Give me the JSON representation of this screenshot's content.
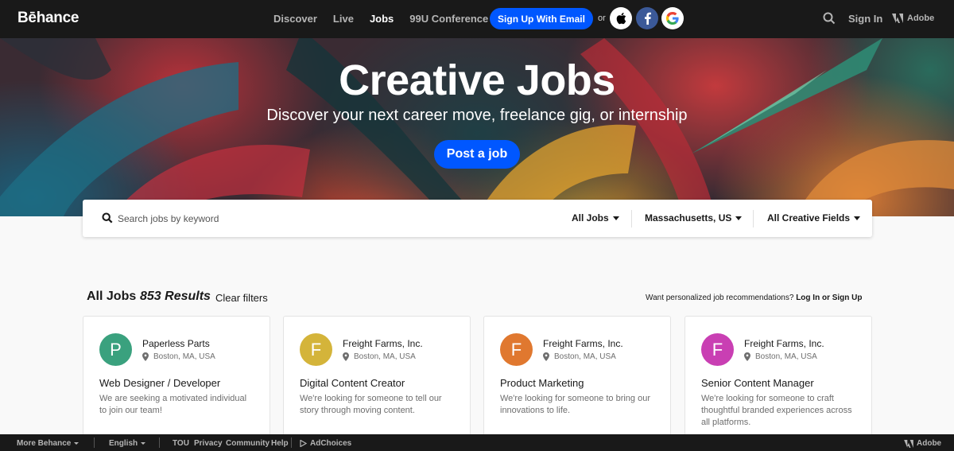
{
  "nav": {
    "logo": "Bēhance",
    "links": [
      "Discover",
      "Live",
      "Jobs",
      "99U Conference"
    ],
    "active": "Jobs",
    "signup_label": "Sign Up With Email",
    "or_label": "or",
    "signin_label": "Sign In",
    "adobe_label": "Adobe",
    "colors": {
      "background": "#191919",
      "accent": "#0057ff",
      "facebook": "#3b5998"
    }
  },
  "hero": {
    "title": "Creative Jobs",
    "subtitle": "Discover your next career move, freelance gig, or internship",
    "post_job_label": "Post a job"
  },
  "search": {
    "placeholder": "Search jobs by keyword",
    "value": "",
    "filters": [
      "All Jobs",
      "Massachusetts, US",
      "All Creative Fields"
    ]
  },
  "results": {
    "title": "All Jobs",
    "count": "853 Results",
    "clear_label": "Clear filters",
    "reco_prompt": "Want personalized job recommendations?",
    "reco_link": "Log In or Sign Up"
  },
  "jobs": [
    {
      "initial": "P",
      "color": "#3aa17e",
      "company": "Paperless Parts",
      "location": "Boston, MA, USA",
      "title": "Web Designer / Developer",
      "description": "We are seeking a motivated individual to join our team!"
    },
    {
      "initial": "F",
      "color": "#d4b43a",
      "company": "Freight Farms, Inc.",
      "location": "Boston, MA, USA",
      "title": "Digital Content Creator",
      "description": "We're looking for someone to tell our story through moving content."
    },
    {
      "initial": "F",
      "color": "#e0782f",
      "company": "Freight Farms, Inc.",
      "location": "Boston, MA, USA",
      "title": "Product Marketing",
      "description": "We're looking for someone to bring our innovations to life."
    },
    {
      "initial": "F",
      "color": "#c93fb3",
      "company": "Freight Farms, Inc.",
      "location": "Boston, MA, USA",
      "title": "Senior Content Manager",
      "description": "We're looking for someone to craft thoughtful branded experiences across all platforms."
    }
  ],
  "footer": {
    "more_label": "More Behance",
    "language_label": "English",
    "links": [
      "TOU",
      "Privacy",
      "Community",
      "Help"
    ],
    "adchoices_label": "AdChoices",
    "adobe_label": "Adobe"
  }
}
